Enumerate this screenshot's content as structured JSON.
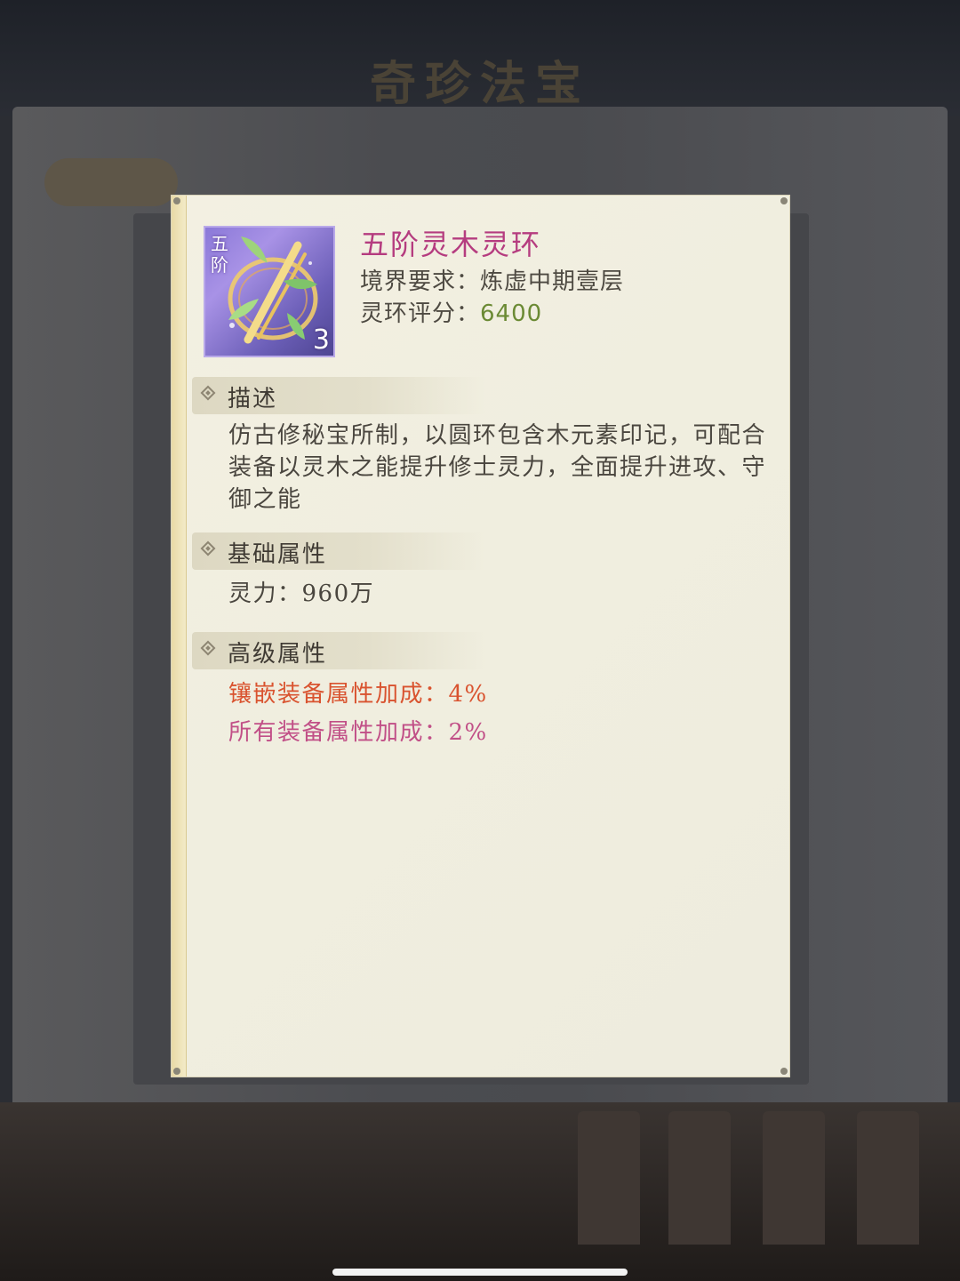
{
  "background": {
    "title": "奇珍法宝"
  },
  "item": {
    "icon": {
      "tier_badge": "五阶",
      "count": "3",
      "icon_name": "jade-bamboo-ring-icon"
    },
    "name": "五阶灵木灵环",
    "requirement_label": "境界要求：",
    "requirement_value": "炼虚中期壹层",
    "score_label": "灵环评分：",
    "score_value": "6400"
  },
  "sections": {
    "description": {
      "title": "描述",
      "text": "仿古修秘宝所制，以圆环包含木元素印记，可配合装备以灵木之能提升修士灵力，全面提升进攻、守御之能"
    },
    "basic": {
      "title": "基础属性",
      "lines": [
        "灵力：960万"
      ]
    },
    "advanced": {
      "title": "高级属性",
      "lines": [
        "镶嵌装备属性加成：4%",
        "所有装备属性加成：2%"
      ]
    }
  },
  "colors": {
    "item_name": "#b53c7f",
    "score": "#6b8a34",
    "advanced_1": "#d9532f",
    "advanced_2": "#c14f87"
  }
}
